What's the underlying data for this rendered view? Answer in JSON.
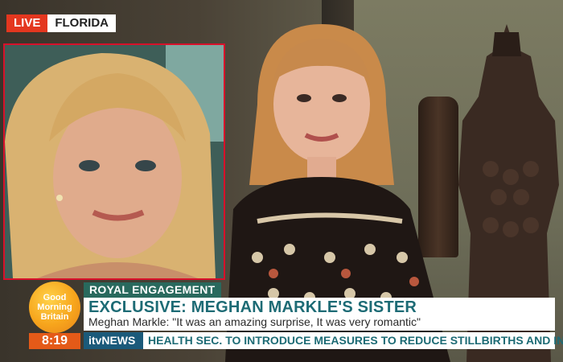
{
  "live_badge": {
    "label": "LIVE",
    "location": "FLORIDA"
  },
  "logo": {
    "line1": "Good",
    "line2": "Morning",
    "line3": "Britain"
  },
  "clock": "8:19",
  "lower_third": {
    "category": "ROYAL ENGAGEMENT",
    "headline": "EXCLUSIVE: MEGHAN MARKLE'S SISTER",
    "subline": "Meghan Markle: \"It was an amazing surprise, It was very romantic\""
  },
  "ticker": {
    "brand": "itvNEWS",
    "text": "HEALTH SEC. TO INTRODUCE MEASURES TO REDUCE STILLBIRTHS AND INJURIES"
  },
  "colors": {
    "live_red": "#e4371f",
    "teal": "#29695d",
    "headline_teal": "#1d6b75",
    "clock_orange": "#e45a18",
    "logo_yellow": "#f7a51c"
  }
}
